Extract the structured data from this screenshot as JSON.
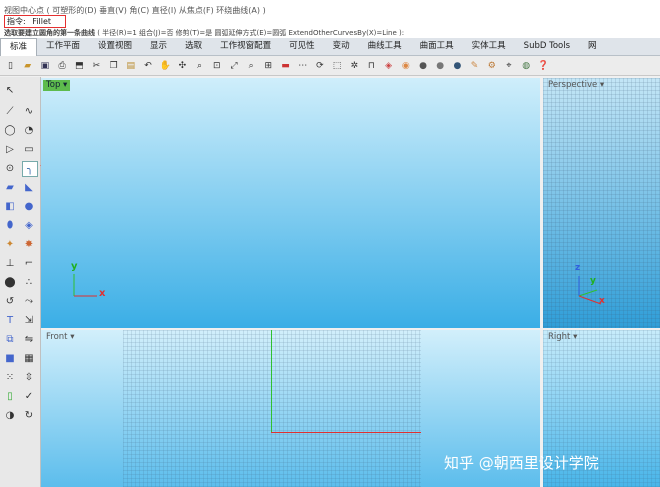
{
  "command_area": {
    "row1_text": "视图中心点 ( 可塑形的(D)  垂直(V)  角(C)  直径(I)  从焦点(F)  环绕曲线(A) )",
    "command_label": "指令:",
    "command_value": "Fillet",
    "row3_bold": "选取要建立圆角的第一条曲线",
    "row3_options": " ( 半径(R)=1  组合(J)=否  修剪(T)=是  圆弧延伸方式(E)=圆弧  ExtendOtherCurvesBy(X)=Line ):"
  },
  "tabs": [
    {
      "label": "标准",
      "active": true
    },
    {
      "label": "工作平面"
    },
    {
      "label": "设置视图"
    },
    {
      "label": "显示"
    },
    {
      "label": "选取"
    },
    {
      "label": "工作视窗配置"
    },
    {
      "label": "可见性"
    },
    {
      "label": "变动"
    },
    {
      "label": "曲线工具"
    },
    {
      "label": "曲面工具"
    },
    {
      "label": "实体工具"
    },
    {
      "label": "SubD Tools"
    },
    {
      "label": "网"
    }
  ],
  "viewports": {
    "top": {
      "label": "Top",
      "axis_y": "y",
      "axis_x": "x"
    },
    "perspective": {
      "label": "Perspective",
      "axis_z": "z",
      "axis_y": "y",
      "axis_x": "x"
    },
    "front": {
      "label": "Front"
    },
    "right": {
      "label": "Right"
    }
  },
  "watermark": "知乎 @朝西里设计学院",
  "colors": {
    "accent_red": "#e53030",
    "active_viewport_label": "#5dbb4d",
    "axis_x": "#e03030",
    "axis_y": "#30c030",
    "axis_z": "#3060e0"
  }
}
